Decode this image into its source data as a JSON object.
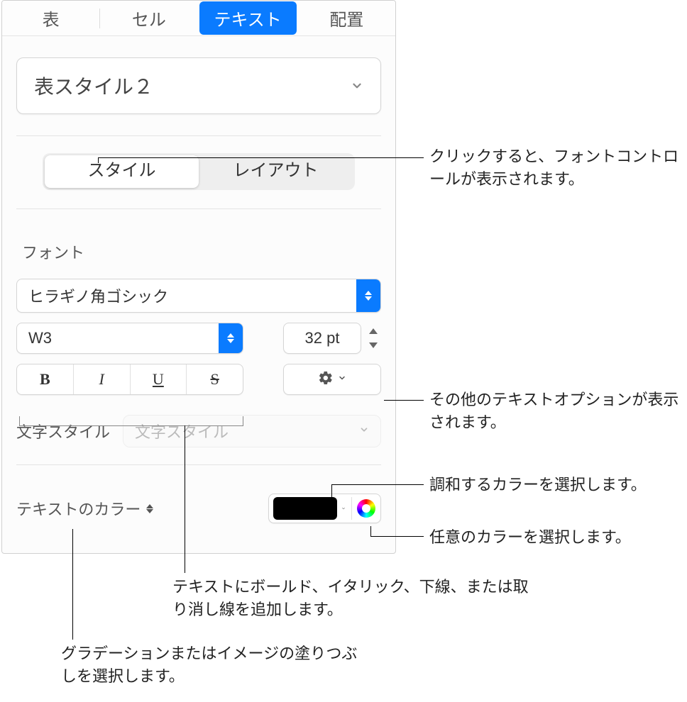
{
  "tabs": {
    "table": "表",
    "cell": "セル",
    "text": "テキスト",
    "arrange": "配置"
  },
  "styleDropdown": {
    "label": "表スタイル２"
  },
  "segments": {
    "style": "スタイル",
    "layout": "レイアウト"
  },
  "font": {
    "section": "フォント",
    "family": "ヒラギノ角ゴシック",
    "weight": "W3",
    "size": "32 pt",
    "bold": "B",
    "italic": "I",
    "underline": "U",
    "strike": "S"
  },
  "charStyle": {
    "label": "文字スタイル",
    "placeholder": "文字スタイル"
  },
  "textColor": {
    "label": "テキストのカラー",
    "swatchHex": "#000000"
  },
  "callouts": {
    "fontControls": "クリックすると、フォントコントロールが表示されます。",
    "moreOptions": "その他のテキストオプションが表示されます。",
    "harmonyColor": "調和するカラーを選択します。",
    "anyColor": "任意のカラーを選択します。",
    "bius": "テキストにボールド、イタリック、下線、または取り消し線を追加します。",
    "gradientFill": "グラデーションまたはイメージの塗りつぶしを選択します。"
  }
}
